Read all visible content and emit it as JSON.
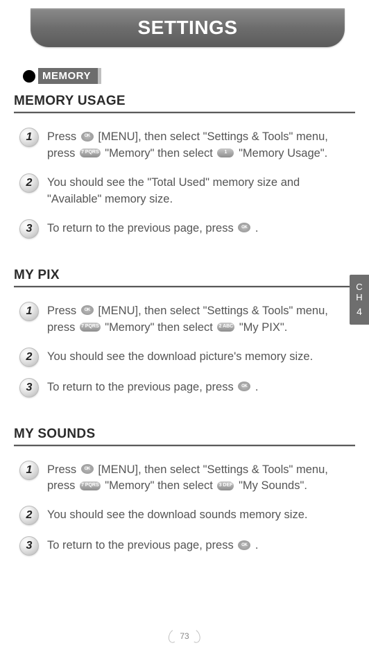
{
  "header": {
    "title": "SETTINGS"
  },
  "section_label": "MEMORY",
  "side_tab": {
    "letters": "C\nH",
    "chapter": "4"
  },
  "page_number": "73",
  "icons": {
    "ok": "OK",
    "key7": "7 PQRS",
    "key1": "1",
    "key2": "2 ABC",
    "key3": "3 DEF"
  },
  "sections": [
    {
      "heading": "MEMORY USAGE",
      "steps": [
        {
          "num": "1",
          "parts": [
            "Press ",
            {
              "icon": "ok"
            },
            " [MENU], then select \"Settings & Tools\" menu, press ",
            {
              "icon": "key7"
            },
            " \"Memory\" then select ",
            {
              "icon": "key1"
            },
            " \"Memory Usage\"."
          ]
        },
        {
          "num": "2",
          "parts": [
            "You should see the \"Total Used\" memory size and \"Available\" memory size."
          ]
        },
        {
          "num": "3",
          "parts": [
            "To return to the previous page, press ",
            {
              "icon": "ok"
            },
            " ."
          ]
        }
      ]
    },
    {
      "heading": "MY PIX",
      "steps": [
        {
          "num": "1",
          "parts": [
            "Press ",
            {
              "icon": "ok"
            },
            " [MENU], then select \"Settings & Tools\" menu, press ",
            {
              "icon": "key7"
            },
            " \"Memory\" then select ",
            {
              "icon": "key2"
            },
            " \"My PIX\"."
          ]
        },
        {
          "num": "2",
          "parts": [
            "You should see the download picture's memory size."
          ]
        },
        {
          "num": "3",
          "parts": [
            "To return to the previous page, press ",
            {
              "icon": "ok"
            },
            " ."
          ]
        }
      ]
    },
    {
      "heading": "MY SOUNDS",
      "steps": [
        {
          "num": "1",
          "parts": [
            "Press ",
            {
              "icon": "ok"
            },
            " [MENU], then select \"Settings & Tools\" menu, press ",
            {
              "icon": "key7"
            },
            " \"Memory\" then select ",
            {
              "icon": "key3"
            },
            " \"My Sounds\"."
          ]
        },
        {
          "num": "2",
          "parts": [
            "You should see the download sounds memory size."
          ]
        },
        {
          "num": "3",
          "parts": [
            "To return to the previous page, press ",
            {
              "icon": "ok"
            },
            " ."
          ]
        }
      ]
    }
  ]
}
